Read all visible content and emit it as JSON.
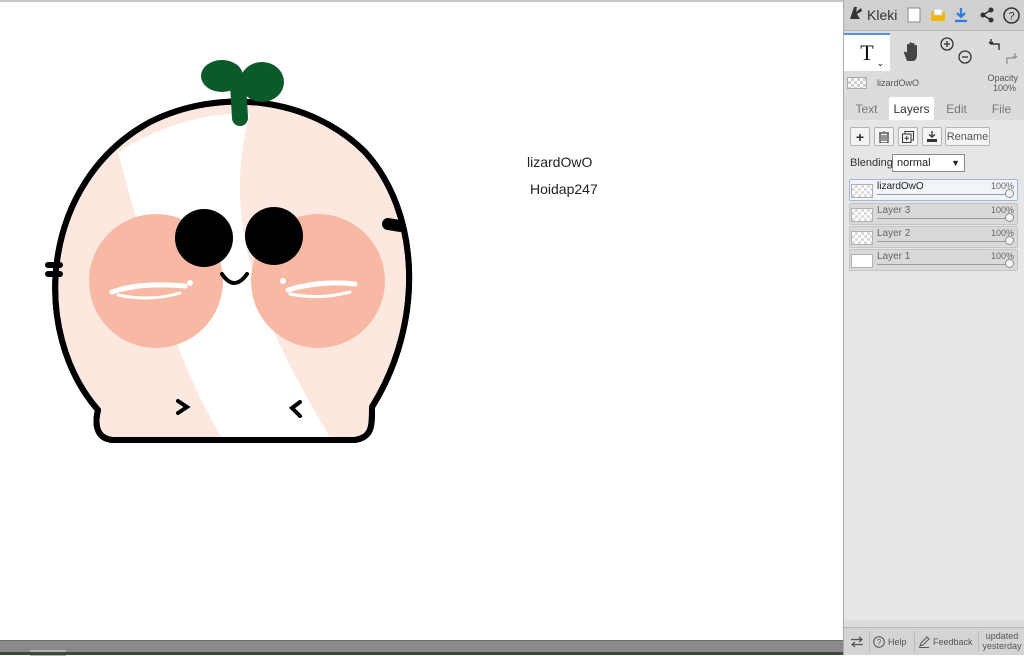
{
  "app": {
    "name": "Kleki"
  },
  "toolbar": {
    "icons": [
      "kleki-logo-icon",
      "new-file-icon",
      "save-folder-icon",
      "download-icon",
      "share-icon",
      "help-icon"
    ]
  },
  "tools": {
    "text_tool": "T",
    "icons": [
      "text-tool-icon",
      "hand-tool-icon",
      "zoom-in-icon",
      "zoom-out-icon",
      "undo-icon",
      "redo-icon"
    ]
  },
  "layer_status": {
    "name": "lizardOwO",
    "opacity_label": "Opacity",
    "opacity_value": "100%"
  },
  "tabs": [
    {
      "label": "Text"
    },
    {
      "label": "Layers"
    },
    {
      "label": "Edit"
    },
    {
      "label": "File"
    }
  ],
  "layers_panel": {
    "rename_label": "Rename",
    "blending_label": "Blending",
    "blending_value": "normal",
    "layers": [
      {
        "name": "lizardOwO",
        "opacity": "100%",
        "selected": true
      },
      {
        "name": "Layer 3",
        "opacity": "100%",
        "selected": false
      },
      {
        "name": "Layer 2",
        "opacity": "100%",
        "selected": false
      },
      {
        "name": "Layer 1",
        "opacity": "100%",
        "selected": false
      }
    ]
  },
  "canvas": {
    "text_line_1": "lizardOwO",
    "text_line_2": "Hoidap247",
    "colors": {
      "outline": "#000000",
      "body_fill": "#fde8e0",
      "blush": "#f8b9a4",
      "sprout": "#0b5a2a"
    }
  },
  "footer": {
    "help_label": "Help",
    "feedback_label": "Feedback",
    "updated_line_1": "updated",
    "updated_line_2": "yesterday"
  },
  "colors": {
    "sidebar_bg": "#dcdcdc",
    "accent": "#5b8fd6",
    "download_blue": "#2a7de1",
    "save_yellow": "#f2b705"
  }
}
